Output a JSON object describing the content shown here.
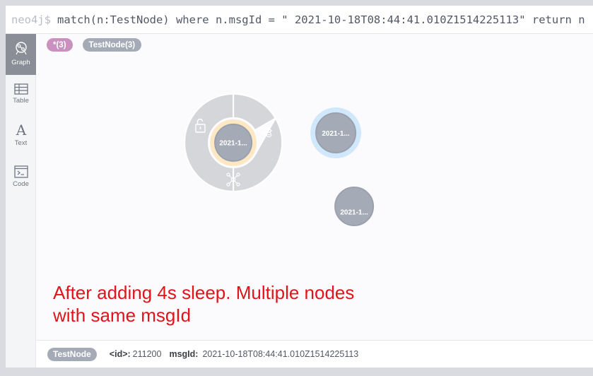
{
  "editor": {
    "prompt": "neo4j$",
    "query": "match(n:TestNode) where n.msgId = \" 2021-10-18T08:44:41.010Z1514225113\" return n"
  },
  "sidebar": {
    "items": [
      {
        "label": "Graph",
        "icon": "graph-icon",
        "active": true
      },
      {
        "label": "Table",
        "icon": "table-icon",
        "active": false
      },
      {
        "label": "Text",
        "icon": "text-icon",
        "active": false
      },
      {
        "label": "Code",
        "icon": "code-icon",
        "active": false
      }
    ]
  },
  "labels": {
    "all": "*(3)",
    "testnode": "TestNode(3)"
  },
  "graph": {
    "nodes": [
      {
        "caption": "2021-1...",
        "state": "selected"
      },
      {
        "caption": "2021-1...",
        "state": "hovered"
      },
      {
        "caption": "2021-1...",
        "state": "default"
      }
    ],
    "ring_actions": [
      "unlock-icon",
      "hide-icon",
      "expand-icon"
    ]
  },
  "annotation": {
    "line1": "After adding 4s sleep. Multiple nodes",
    "line2": "with same msgId"
  },
  "details": {
    "label": "TestNode",
    "id_key": "<id>:",
    "id_value": "211200",
    "msgid_key": "msgId:",
    "msgid_value": "2021-10-18T08:44:41.010Z1514225113"
  },
  "colors": {
    "node_fill": "#a5abb6",
    "node_stroke": "#9aa1ac",
    "selected_ring": "#fde8c3",
    "hover_ring": "#d0e8fb",
    "ring_menu": "#d4d6da",
    "annotation": "#e0141a",
    "tag_all": "#c990c0",
    "tag_label": "#a5abb6"
  }
}
